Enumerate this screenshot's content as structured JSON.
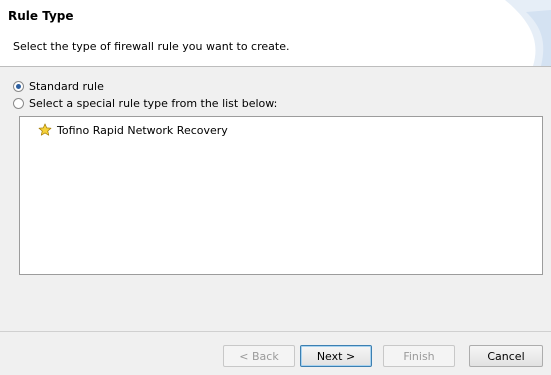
{
  "header": {
    "title": "Rule Type",
    "description": "Select the type of firewall rule you want to create."
  },
  "options": [
    {
      "label": "Standard rule",
      "checked": true
    },
    {
      "label": "Select a special rule type from the list below:",
      "checked": false
    }
  ],
  "special_rules": [
    {
      "label": "Tofino Rapid Network Recovery",
      "icon": "star-icon"
    }
  ],
  "buttons": {
    "back": "< Back",
    "next": "Next >",
    "finish": "Finish",
    "cancel": "Cancel"
  }
}
